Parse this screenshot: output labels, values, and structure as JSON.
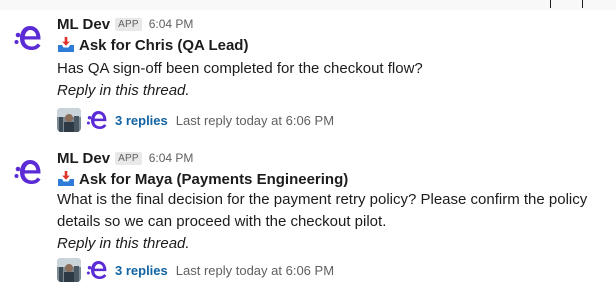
{
  "messages": [
    {
      "sender": "ML Dev",
      "badge": "APP",
      "time": "6:04 PM",
      "title": "Ask for Chris (QA Lead)",
      "body_lines": [
        "Has QA sign-off been completed for the checkout flow?"
      ],
      "note": "Reply in this thread.",
      "replies_label": "3 replies",
      "last_reply": "Last reply today at 6:06 PM"
    },
    {
      "sender": "ML Dev",
      "badge": "APP",
      "time": "6:04 PM",
      "title": "Ask for Maya (Payments Engineering)",
      "body_lines": [
        "What is the final decision for the payment retry policy? Please confirm the policy",
        "details so we can proceed with the checkout pilot."
      ],
      "note": "Reply in this thread.",
      "replies_label": "3 replies",
      "last_reply": "Last reply today at 6:06 PM"
    }
  ],
  "icons": {
    "bot_avatar": "e-bot-avatar-icon",
    "inbox": "inbox-tray-icon",
    "user_avatar": "user-avatar-photo"
  },
  "colors": {
    "bot_purple": "#5b2bd6",
    "link_blue": "#1264a3",
    "muted": "#616061",
    "inbox_blue": "#2f7bd8",
    "inbox_red": "#e0332c"
  }
}
